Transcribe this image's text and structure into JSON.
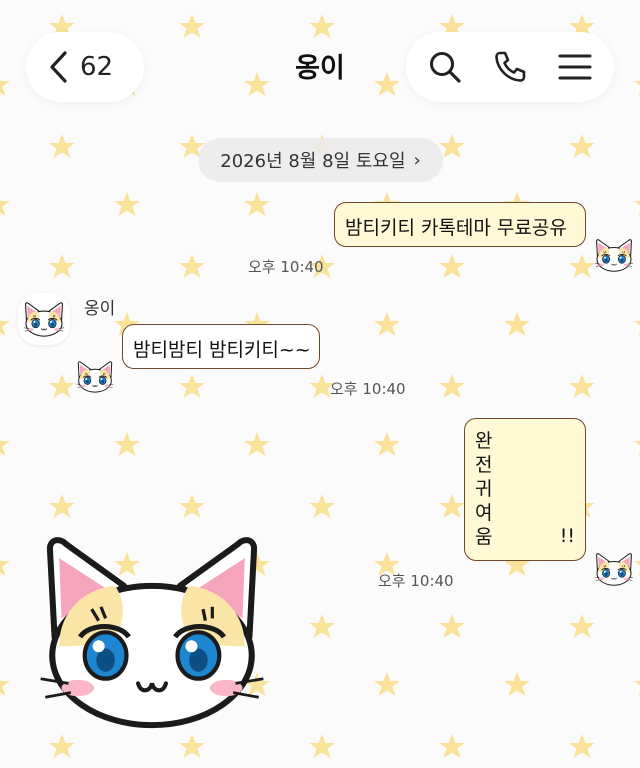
{
  "header": {
    "back_count": "62",
    "title": "옹이"
  },
  "icons": {
    "back": "chevron-left-icon",
    "search": "search-icon",
    "call": "phone-icon",
    "menu": "hamburger-menu-icon",
    "sticker": "cat-face-icon"
  },
  "date_divider": {
    "label": "2026년 8월 8일 토요일",
    "chevron": "›"
  },
  "messages": [
    {
      "side": "right",
      "text": "밤티키티 카톡테마 무료공유",
      "time": "오후 10:40"
    },
    {
      "side": "left",
      "sender": "옹이",
      "text": "밤티밤티 밤티키티~~",
      "time": "오후 10:40"
    },
    {
      "side": "right",
      "lines": [
        "완",
        "전",
        "귀",
        "여",
        "움"
      ],
      "suffix": "!!",
      "time": "오후 10:40"
    }
  ],
  "colors": {
    "bubble_bg": "#fff9d6",
    "bubble_border": "#6e4a2c",
    "star": "#f9e29a"
  }
}
